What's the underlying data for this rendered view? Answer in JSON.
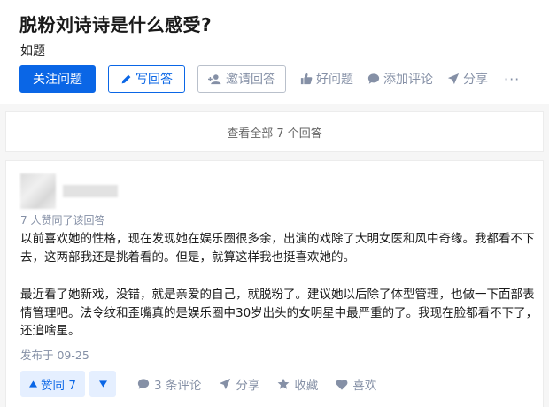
{
  "question": {
    "title": "脱粉刘诗诗是什么感受?",
    "detail": "如题"
  },
  "actions": {
    "follow": "关注问题",
    "write": "写回答",
    "invite": "邀请回答",
    "good_question": "好问题",
    "add_comment": "添加评论",
    "share": "分享",
    "more": "···"
  },
  "view_all": "查看全部 7 个回答",
  "answer": {
    "upvote_summary": "7 人赞同了该回答",
    "paragraphs": [
      "以前喜欢她的性格，现在发现她在娱乐圈很多余，出演的戏除了大明女医和风中奇缘。我都看不下去，这两部我还是挑着看的。但是，就算这样我也挺喜欢她的。",
      "最近看了她新戏，没错，就是亲爱的自己，就脱粉了。建议她以后除了体型管理，也做一下面部表情管理吧。法令纹和歪嘴真的是娱乐圈中30岁出头的女明星中最严重的了。我现在脸都看不下了，还追啥星。"
    ],
    "published": "发布于 09-25",
    "footer": {
      "vote_up": "赞同 7",
      "comments": "3 条评论",
      "share": "分享",
      "favorite": "收藏",
      "like": "喜欢"
    }
  },
  "colors": {
    "brand_blue": "#0a66e6",
    "muted": "#8590a6",
    "vote_bg": "#e5efff"
  }
}
